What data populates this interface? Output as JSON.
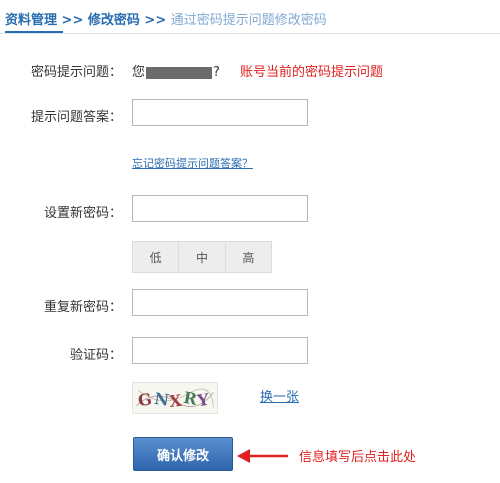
{
  "breadcrumb": {
    "item1": "资料管理",
    "sep1": ">>",
    "item2": "修改密码",
    "sep2": ">>",
    "current": "通过密码提示问题修改密码"
  },
  "form": {
    "question_label": "密码提示问题：",
    "question_prefix": "您",
    "question_suffix": "?",
    "question_note": "账号当前的密码提示问题",
    "answer_label": "提示问题答案：",
    "answer_value": "",
    "forgot_link": "忘记密码提示问题答案？",
    "new_password_label": "设置新密码：",
    "new_password_value": "",
    "strength_levels": [
      "低",
      "中",
      "高"
    ],
    "repeat_password_label": "重复新密码：",
    "repeat_password_value": "",
    "captcha_label": "验证码：",
    "captcha_value": "",
    "captcha_text": "GNXRY",
    "refresh_link": "换一张",
    "submit_label": "确认修改",
    "submit_note": "信息填写后点击此处"
  },
  "colors": {
    "link": "#2a6db1",
    "annotation": "#e02020",
    "button": "#2d65ad"
  }
}
